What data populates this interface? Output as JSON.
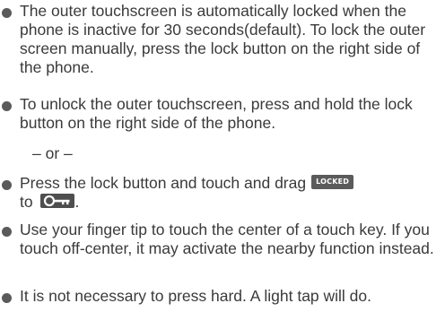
{
  "items": [
    {
      "text": "The outer touchscreen is automatically locked when the phone is inactive for 30 seconds(default). To lock the outer screen manually, press the lock button on the right side of the phone."
    },
    {
      "text": "To unlock the outer touchscreen, press and hold the lock button on the right side of the phone."
    },
    {
      "or_text": "– or –"
    },
    {
      "text_before": "Press the lock button and touch and drag",
      "badge": "LOCKED",
      "text_mid": "to",
      "icon": "key-icon",
      "text_after": "."
    },
    {
      "text": "Use your finger tip to touch the center of a touch key. If you touch off-center, it may activate the nearby function instead."
    },
    {
      "text": "It is not necessary to press hard. A light tap will do."
    }
  ],
  "colors": {
    "text": "#3a3a3a",
    "bullet": "#5a5a5a",
    "badge_bg": "#5b5b5b",
    "badge_text": "#ffffff"
  }
}
